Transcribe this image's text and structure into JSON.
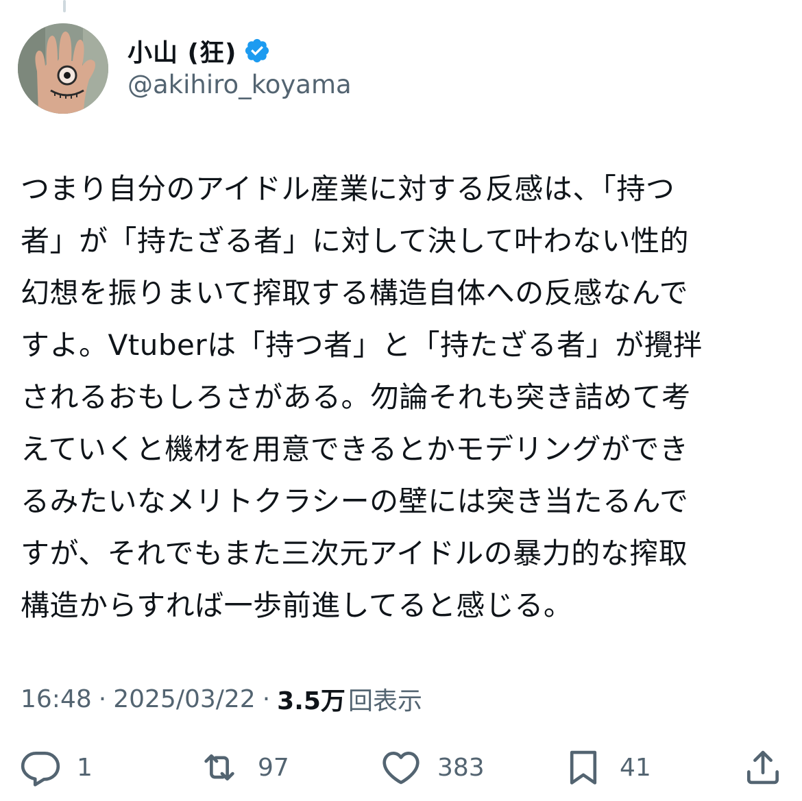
{
  "author": {
    "display_name": "小山 (狂)",
    "handle": "@akihiro_koyama",
    "verified": true,
    "verified_color": "#1d9bf0"
  },
  "tweet": {
    "lines": [
      "つまり自分のアイドル産業に対する反感は、「持つ",
      "者」が「持たざる者」に対して決して叶わない性的",
      "幻想を振りまいて搾取する構造自体への反感なんで",
      "すよ。Vtuberは「持つ者」と「持たざる者」が攪拌",
      "されるおもしろさがある。勿論それも突き詰めて考",
      "えていくと機材を用意できるとかモデリングができ",
      "るみたいなメリトクラシーの壁には突き当たるんで",
      "すが、それでもまた三次元アイドルの暴力的な搾取",
      "構造からすれば一歩前進してると感じる。"
    ]
  },
  "meta": {
    "time": "16:48",
    "separator": "·",
    "date": "2025/03/22",
    "views_count": "3.5万",
    "views_label": "回表示"
  },
  "actions": {
    "reply": {
      "icon": "reply-icon",
      "count": "1"
    },
    "retweet": {
      "icon": "retweet-icon",
      "count": "97"
    },
    "like": {
      "icon": "heart-icon",
      "count": "383"
    },
    "bookmark": {
      "icon": "bookmark-icon",
      "count": "41"
    },
    "share": {
      "icon": "share-icon"
    }
  },
  "colors": {
    "text_primary": "#0f1419",
    "text_secondary": "#536471"
  }
}
